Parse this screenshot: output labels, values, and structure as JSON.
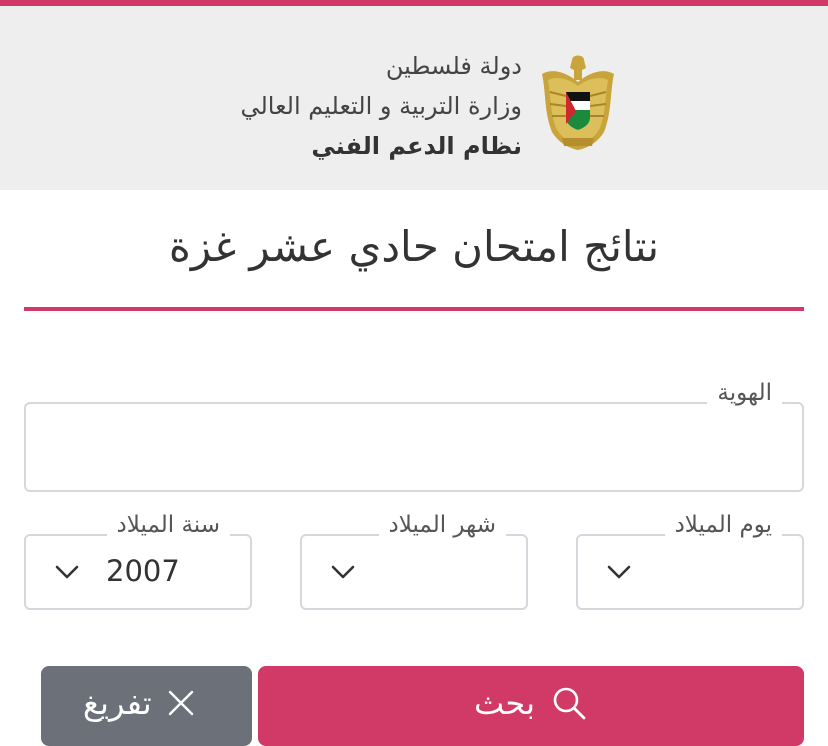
{
  "header": {
    "line1": "دولة فلسطين",
    "line2": "وزارة التربية و التعليم العالي",
    "line3": "نظام الدعم الفني"
  },
  "page": {
    "title": "نتائج امتحان حادي عشر غزة"
  },
  "form": {
    "id_label": "الهوية",
    "id_value": "",
    "birth_day_label": "يوم الميلاد",
    "birth_day_value": "",
    "birth_month_label": "شهر الميلاد",
    "birth_month_value": "",
    "birth_year_label": "سنة الميلاد",
    "birth_year_value": "2007"
  },
  "buttons": {
    "search_label": "بحث",
    "clear_label": "تفريغ"
  },
  "colors": {
    "accent": "#d13a66",
    "secondary_button": "#6b7079",
    "header_bg": "#efeeef"
  },
  "icons": {
    "emblem": "palestine-eagle-emblem",
    "search": "search-icon",
    "clear": "close-icon",
    "dropdown": "chevron-down-icon"
  }
}
